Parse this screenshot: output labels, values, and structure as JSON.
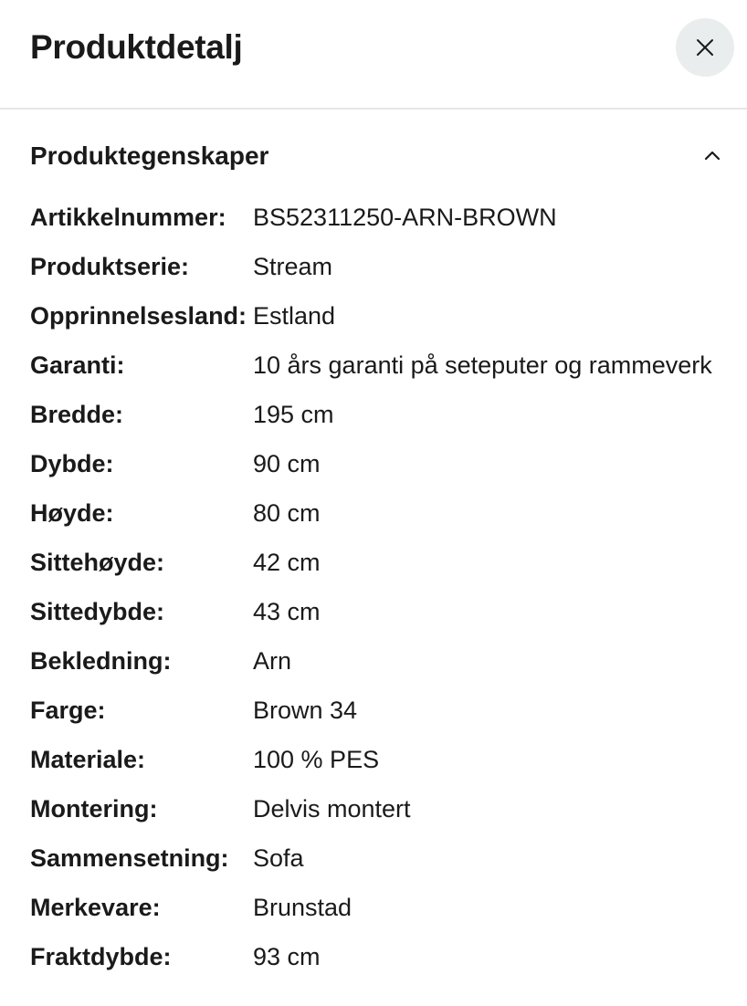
{
  "header": {
    "title": "Produktdetalj",
    "close_icon": "close-icon"
  },
  "section": {
    "title": "Produktegenskaper",
    "expanded": true,
    "toggle_icon": "chevron-up-icon"
  },
  "properties": [
    {
      "label": "Artikkelnummer:",
      "value": "BS52311250-ARN-BROWN"
    },
    {
      "label": "Produktserie:",
      "value": "Stream"
    },
    {
      "label": "Opprinnelsesland:",
      "value": "Estland"
    },
    {
      "label": "Garanti:",
      "value": "10 års garanti på seteputer og rammeverk"
    },
    {
      "label": "Bredde:",
      "value": "195 cm"
    },
    {
      "label": "Dybde:",
      "value": "90 cm"
    },
    {
      "label": "Høyde:",
      "value": "80 cm"
    },
    {
      "label": "Sittehøyde:",
      "value": "42 cm"
    },
    {
      "label": "Sittedybde:",
      "value": "43 cm"
    },
    {
      "label": "Bekledning:",
      "value": "Arn"
    },
    {
      "label": "Farge:",
      "value": "Brown 34"
    },
    {
      "label": "Materiale:",
      "value": "100 % PES"
    },
    {
      "label": "Montering:",
      "value": "Delvis montert"
    },
    {
      "label": "Sammensetning:",
      "value": "Sofa"
    },
    {
      "label": "Merkevare:",
      "value": "Brunstad"
    },
    {
      "label": "Fraktdybde:",
      "value": "93 cm"
    }
  ],
  "colors": {
    "text": "#1a1a1a",
    "close_button_bg": "#e9eded",
    "divider": "#e6e6e6"
  }
}
